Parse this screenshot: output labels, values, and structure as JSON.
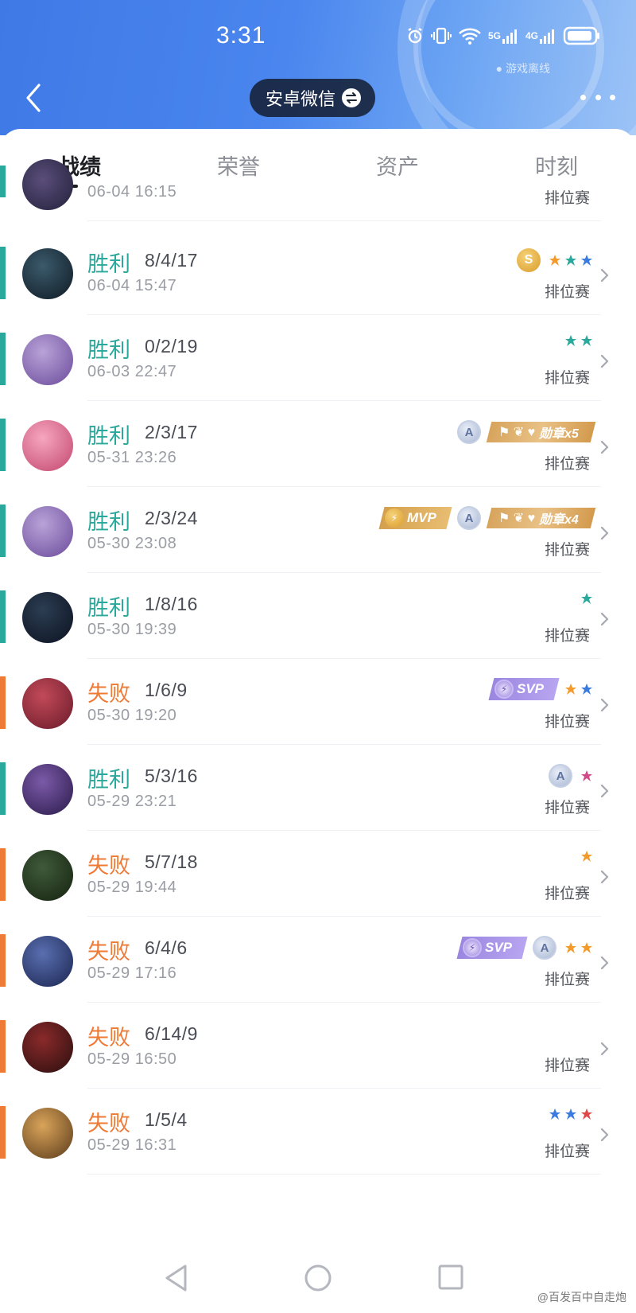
{
  "status_bar": {
    "time": "3:31",
    "net1": "5G",
    "net2": "4G"
  },
  "header": {
    "switch_label": "安卓微信",
    "offline_text": "游戏离线"
  },
  "tabs": [
    {
      "label": "战绩"
    },
    {
      "label": "荣誉"
    },
    {
      "label": "资产"
    },
    {
      "label": "时刻"
    }
  ],
  "partial_row": {
    "time": "06-04 16:15",
    "mode": "排位赛"
  },
  "matches": [
    {
      "result": "胜利",
      "kda": "8/4/17",
      "time": "06-04 15:47",
      "mode": "排位赛",
      "outcome": "win",
      "coin": "S"
    },
    {
      "result": "胜利",
      "kda": "0/2/19",
      "time": "06-03 22:47",
      "mode": "排位赛",
      "outcome": "win"
    },
    {
      "result": "胜利",
      "kda": "2/3/17",
      "time": "05-31 23:26",
      "mode": "排位赛",
      "outcome": "win",
      "medal": "勋章x5"
    },
    {
      "result": "胜利",
      "kda": "2/3/24",
      "time": "05-30 23:08",
      "mode": "排位赛",
      "outcome": "win",
      "medal": "勋章x4",
      "mvp": "MVP"
    },
    {
      "result": "胜利",
      "kda": "1/8/16",
      "time": "05-30 19:39",
      "mode": "排位赛",
      "outcome": "win"
    },
    {
      "result": "失败",
      "kda": "1/6/9",
      "time": "05-30 19:20",
      "mode": "排位赛",
      "outcome": "loss",
      "svp": "SVP"
    },
    {
      "result": "胜利",
      "kda": "5/3/16",
      "time": "05-29 23:21",
      "mode": "排位赛",
      "outcome": "win"
    },
    {
      "result": "失败",
      "kda": "5/7/18",
      "time": "05-29 19:44",
      "mode": "排位赛",
      "outcome": "loss"
    },
    {
      "result": "失败",
      "kda": "6/4/6",
      "time": "05-29 17:16",
      "mode": "排位赛",
      "outcome": "loss",
      "svp": "SVP"
    },
    {
      "result": "失败",
      "kda": "6/14/9",
      "time": "05-29 16:50",
      "mode": "排位赛",
      "outcome": "loss"
    },
    {
      "result": "失败",
      "kda": "1/5/4",
      "time": "05-29 16:31",
      "mode": "排位赛",
      "outcome": "loss"
    }
  ],
  "badge_letter": "A",
  "colors": {
    "win": "#2aa89b",
    "loss": "#ee7a36",
    "header_blue": "#4a86ee"
  },
  "watermark": "@百发百中自走炮"
}
